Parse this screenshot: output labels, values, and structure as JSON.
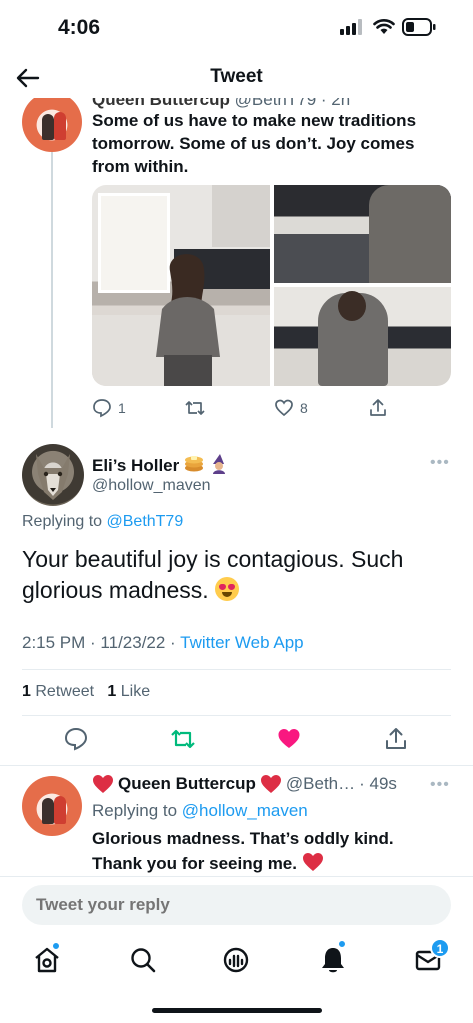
{
  "status_bar": {
    "time": "4:06"
  },
  "header": {
    "title": "Tweet"
  },
  "parent_tweet": {
    "name_fragment": "Queen Buttercup",
    "handle_fragment": "@BethT79 · 2h",
    "text": "Some of us have to make new traditions tomorrow. Some of us don’t. Joy comes from within.",
    "reply_count": "1",
    "like_count": "8"
  },
  "main_tweet": {
    "display_name": "Eli’s Holler",
    "handle": "@hollow_maven",
    "replying_prefix": "Replying to",
    "replying_to": "@BethT79",
    "body": "Your beautiful joy is contagious.  Such glorious madness.",
    "time": "2:15 PM · 11/23/22 · ",
    "source": "Twitter Web App",
    "retweet_count": "1",
    "retweet_label": "Retweet",
    "like_count": "1",
    "like_label": "Like"
  },
  "reply_tweet": {
    "display_name": "Queen Buttercup",
    "handle": "@Beth…",
    "time": "· 49s",
    "replying_prefix": "Replying to",
    "replying_to": "@hollow_maven",
    "text": "Glorious madness. That’s oddly kind. Thank you for seeing me."
  },
  "compose": {
    "placeholder": "Tweet your reply"
  },
  "tabbar": {
    "messages_badge": "1"
  },
  "colors": {
    "accent": "#1d9bf0",
    "retweet": "#00ba7c",
    "like": "#f91880",
    "text_secondary": "#536471"
  }
}
